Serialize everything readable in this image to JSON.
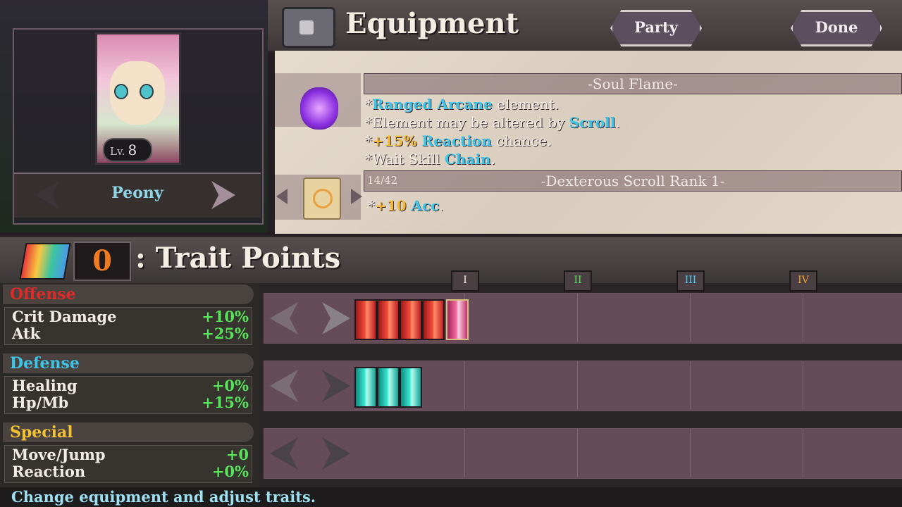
{
  "header": {
    "title": "Equipment",
    "party_label": "Party",
    "done_label": "Done"
  },
  "character": {
    "level_label": "Lv.",
    "level": "8",
    "name": "Peony"
  },
  "item": {
    "title": "-Soul Flame-",
    "lines": [
      {
        "pre": "*",
        "kw": "Ranged Arcane",
        "post": " element."
      },
      {
        "pre": "*Element may be altered by ",
        "kw": "Scroll",
        "post": "."
      },
      {
        "pre": "*",
        "kw_gold": "+15%",
        "kw": " Reaction",
        "post": " chance."
      },
      {
        "pre": "*Wait Skill ",
        "kw": "Chain",
        "post": "."
      }
    ]
  },
  "scroll": {
    "count": "14/42",
    "title": "-Dexterous Scroll Rank 1-",
    "line": {
      "pre": "*",
      "kw_gold": "+10",
      "kw": " Acc",
      "post": "."
    }
  },
  "traits": {
    "points": "0",
    "label": ": Trait Points",
    "tiers": [
      "I",
      "II",
      "III",
      "IV"
    ]
  },
  "stats": {
    "offense": {
      "title": "Offense",
      "color": "#e02a2a",
      "rows": [
        {
          "name": "Crit Damage",
          "value": "+10%"
        },
        {
          "name": "Atk",
          "value": "+25%"
        }
      ]
    },
    "defense": {
      "title": "Defense",
      "color": "#3ec4e8",
      "rows": [
        {
          "name": "Healing",
          "value": "+0%"
        },
        {
          "name": "Hp/Mb",
          "value": "+15%"
        }
      ]
    },
    "special": {
      "title": "Special",
      "color": "#f2c230",
      "rows": [
        {
          "name": "Move/Jump",
          "value": "+0"
        },
        {
          "name": "Reaction",
          "value": "+0%"
        }
      ]
    }
  },
  "trait_rows": [
    {
      "category": "offense",
      "filled": 5,
      "color": "red"
    },
    {
      "category": "defense",
      "filled": 3,
      "color": "teal"
    },
    {
      "category": "special",
      "filled": 0,
      "color": "gold"
    }
  ],
  "footer": "Change equipment and adjust traits."
}
